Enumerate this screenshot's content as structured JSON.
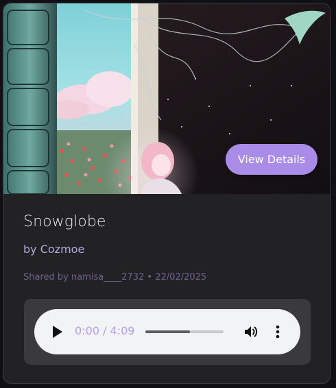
{
  "card": {
    "title": "Snowglobe",
    "artist": "by Cozmoe",
    "shared": "Shared by namisa____2732 • 22/02/2025",
    "view_button": "View Details",
    "cover_art": {
      "description_icon": "cover-artwork",
      "accent": "#a88ce8"
    }
  },
  "player": {
    "time": "0:00 / 4:09",
    "progress_fraction": 0.57,
    "icons": {
      "play": "play-icon",
      "volume": "volume-icon",
      "more": "more-vertical-icon"
    }
  },
  "colors": {
    "card_bg": "#222224",
    "button": "#a88ce8",
    "title": "#e8e6f0",
    "artist": "#b7a8e0",
    "shared": "#6e628f",
    "time": "#b59df2"
  }
}
